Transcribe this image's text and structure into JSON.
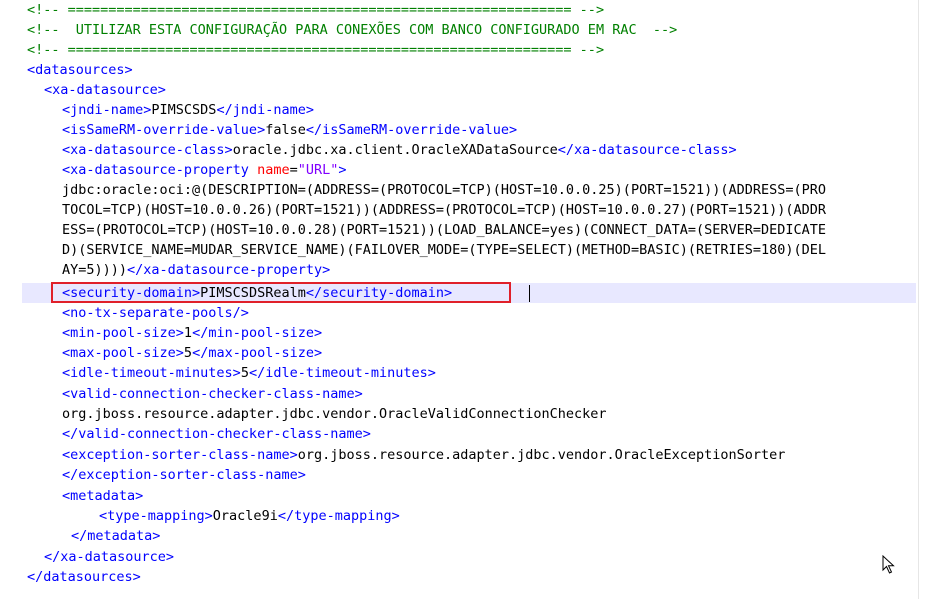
{
  "comments": {
    "rule_top": "<!-- ============================================================== -->",
    "title": "<!--  UTILIZAR ESTA CONFIGURAÇÃO PARA CONEXÕES COM BANCO CONFIGURADO EM RAC  -->",
    "rule_bottom": "<!-- ============================================================== -->"
  },
  "tags": {
    "datasources_open": "<datasources>",
    "xa_datasource_open": "<xa-datasource>",
    "jndi_open": "<jndi-name>",
    "jndi_close": "</jndi-name>",
    "issamerm_open": "<isSameRM-override-value>",
    "issamerm_close": "</isSameRM-override-value>",
    "xaclass_open": "<xa-datasource-class>",
    "xaclass_close": "</xa-datasource-class>",
    "xaprop_open_start": "<xa-datasource-property ",
    "xaprop_attr_name": "name",
    "xaprop_attr_eq": "=",
    "xaprop_attr_value": "\"URL\"",
    "xaprop_open_end": ">",
    "xaprop_close": "</xa-datasource-property>",
    "security_open": "<security-domain>",
    "security_close": "</security-domain>",
    "no_tx": "<no-tx-separate-pools/>",
    "minpool_open": "<min-pool-size>",
    "minpool_close": "</min-pool-size>",
    "maxpool_open": "<max-pool-size>",
    "maxpool_close": "</max-pool-size>",
    "idle_open": "<idle-timeout-minutes>",
    "idle_close": "</idle-timeout-minutes>",
    "checker_open": "<valid-connection-checker-class-name>",
    "checker_close": "</valid-connection-checker-class-name>",
    "sorter_open": "<exception-sorter-class-name>",
    "sorter_close": "</exception-sorter-class-name>",
    "metadata_open": "<metadata>",
    "typemap_open": "<type-mapping>",
    "typemap_close": "</type-mapping>",
    "metadata_close": "</metadata>",
    "xa_datasource_close": "</xa-datasource>",
    "datasources_close": "</datasources>"
  },
  "values": {
    "jndi_name": "PIMSCSDS",
    "issamerm": "false",
    "xa_class": "oracle.jdbc.xa.client.OracleXADataSource",
    "url_line1": "jdbc:oracle:oci:@(DESCRIPTION=(ADDRESS=(PROTOCOL=TCP)(HOST=10.0.0.25)(PORT=1521))(ADDRESS=(PRO",
    "url_line2": "TOCOL=TCP)(HOST=10.0.0.26)(PORT=1521))(ADDRESS=(PROTOCOL=TCP)(HOST=10.0.0.27)(PORT=1521))(ADDR",
    "url_line3": "ESS=(PROTOCOL=TCP)(HOST=10.0.0.28)(PORT=1521))(LOAD_BALANCE=yes)(CONNECT_DATA=(SERVER=DEDICATE",
    "url_line4": "D)(SERVICE_NAME=MUDAR_SERVICE_NAME)(FAILOVER_MODE=(TYPE=SELECT)(METHOD=BASIC)(RETRIES=180)(DEL",
    "url_line5": "AY=5))))",
    "security_domain": "PIMSCSDSRealm",
    "min_pool": "1",
    "max_pool": "5",
    "idle_timeout": "5",
    "checker_class": "org.jboss.resource.adapter.jdbc.vendor.OracleValidConnectionChecker",
    "sorter_class": "org.jboss.resource.adapter.jdbc.vendor.OracleExceptionSorter",
    "type_mapping": "Oracle9i"
  },
  "icons": {
    "mouse_pointer": "arrow-cursor-icon"
  },
  "colors": {
    "tag": "#0000ff",
    "attribute": "#ff0000",
    "attribute_value": "#8000ff",
    "comment": "#008000",
    "highlight_box": "#e0202a",
    "current_line": "#e8e8ff"
  }
}
